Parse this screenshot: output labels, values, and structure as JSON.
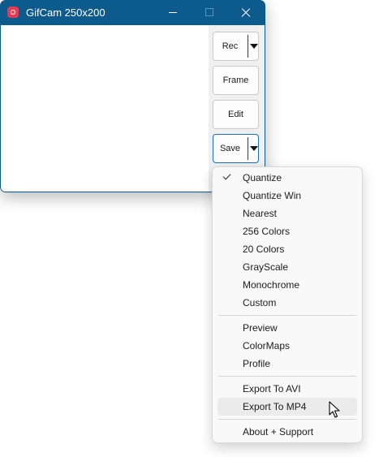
{
  "window": {
    "title": "GifCam 250x200"
  },
  "buttons": {
    "rec": "Rec",
    "frame": "Frame",
    "edit": "Edit",
    "save": "Save"
  },
  "menu": {
    "quantize": "Quantize",
    "quantize_win": "Quantize Win",
    "nearest": "Nearest",
    "colors_256": "256 Colors",
    "colors_20": "20 Colors",
    "grayscale": "GrayScale",
    "monochrome": "Monochrome",
    "custom": "Custom",
    "preview": "Preview",
    "colormaps": "ColorMaps",
    "profile": "Profile",
    "export_avi": "Export To AVI",
    "export_mp4": "Export To MP4",
    "about": "About + Support",
    "checked_item": "Quantize",
    "hovered_item": "Export To MP4"
  },
  "colors": {
    "titlebar": "#0d5a8c",
    "app_icon": "#e23b52",
    "active_border": "#1a6fb0"
  }
}
